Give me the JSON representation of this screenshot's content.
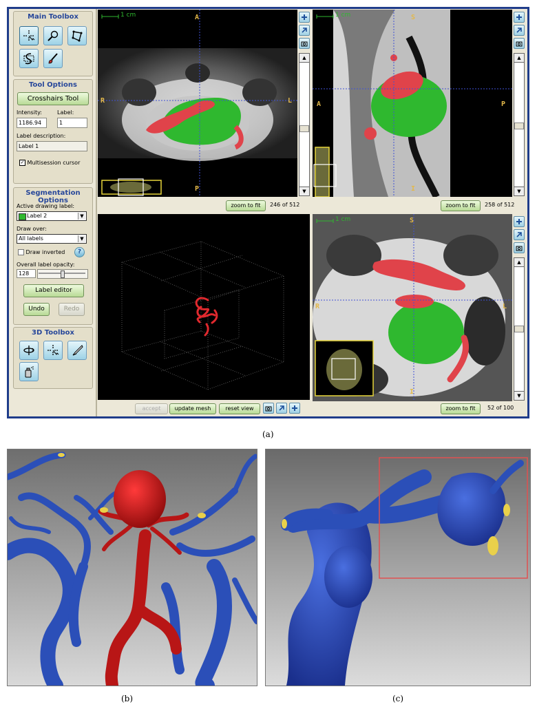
{
  "main_toolbox": {
    "title": "Main Toolbox"
  },
  "tool_options": {
    "title": "Tool Options",
    "active_tool": "Crosshairs Tool",
    "intensity_label": "Intensity:",
    "intensity_value": "1186.94",
    "label_label": "Label:",
    "label_value": "1",
    "description_label": "Label description:",
    "description_value": "Label 1",
    "multisession_label": "Multisession cursor",
    "multisession_checked": true
  },
  "segmentation": {
    "title": "Segmentation Options",
    "active_label_caption": "Active drawing label:",
    "active_label": "Label 2",
    "active_label_color": "#2fb82f",
    "draw_over_caption": "Draw over:",
    "draw_over": "All labels",
    "draw_inverted": "Draw inverted",
    "help": "?",
    "opacity_caption": "Overall label opacity:",
    "opacity_value": "128",
    "label_editor": "Label editor",
    "undo": "Undo",
    "redo": "Redo"
  },
  "toolbox_3d": {
    "title": "3D Toolbox"
  },
  "axial": {
    "scale": "1 cm",
    "top": "A",
    "bottom": "P",
    "left": "R",
    "right": "L",
    "zoom": "zoom to fit",
    "slice": "246 of 512"
  },
  "sagittal": {
    "scale": "1 cm",
    "top": "S",
    "bottom": "I",
    "left": "A",
    "right": "P",
    "zoom": "zoom to fit",
    "slice": "258 of 512"
  },
  "coronal": {
    "scale": "1 cm",
    "top": "S",
    "bottom": "I",
    "left": "R",
    "right": "L",
    "zoom": "zoom to fit",
    "slice": "52 of 100"
  },
  "view3d": {
    "accept": "accept",
    "update": "update mesh",
    "reset": "reset view"
  },
  "icons": {
    "plus": "+"
  },
  "captions": {
    "a": "(a)",
    "b": "(b)",
    "c": "(c)"
  },
  "colors": {
    "segment_green": "#2fb82f",
    "segment_red": "#e0434a",
    "vessel_blue": "#2b4fb8",
    "aneurysm_red": "#c8181c",
    "frame_blue": "#1f3c8a",
    "crosshair": "#3f51d6",
    "highlight": "#e7d63a"
  }
}
